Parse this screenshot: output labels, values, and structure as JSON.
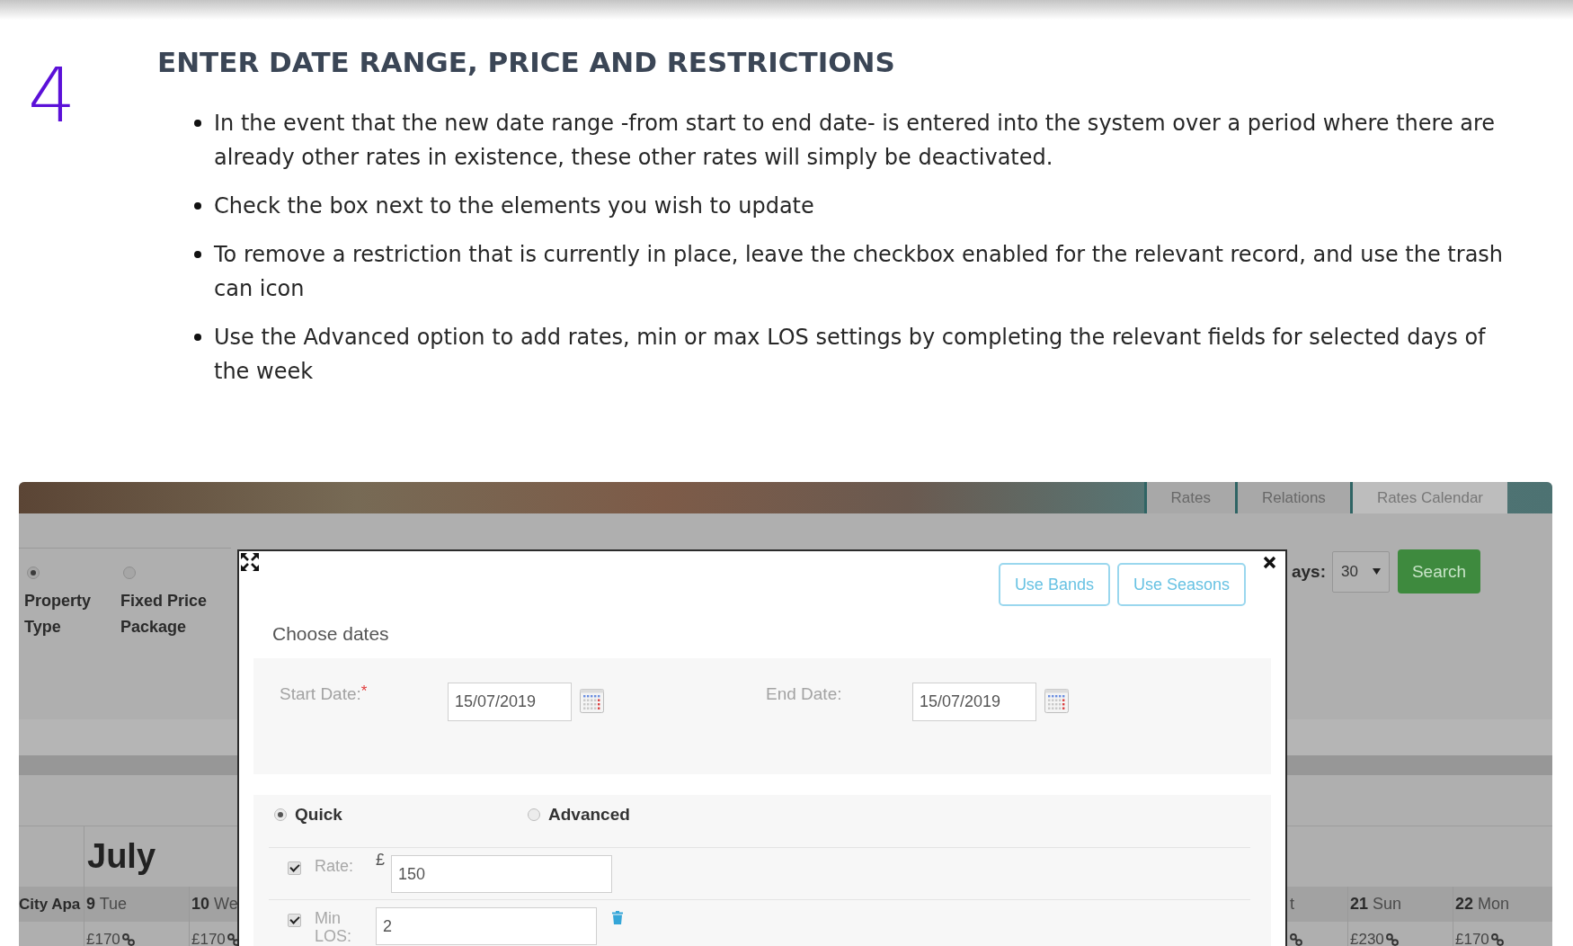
{
  "step": {
    "number": "4",
    "title": "ENTER DATE RANGE, PRICE AND RESTRICTIONS",
    "bullets": [
      "In the event that the new date range -from start to end date- is entered into the system over a period where there are already other rates in existence, these other rates will simply be deactivated.",
      "Check the box next to the elements you wish to update",
      "To remove a restriction that is currently in place, leave the checkbox enabled for the relevant record, and use the trash can icon",
      "Use the Advanced option to add rates, min or max LOS settings by completing the relevant fields for selected days of the week"
    ]
  },
  "screenshot": {
    "tabs": [
      {
        "label": "Rates",
        "selected": false
      },
      {
        "label": "Relations",
        "selected": false
      },
      {
        "label": "Rates Calendar",
        "selected": true
      }
    ],
    "view_options": [
      {
        "label": "Property Type",
        "selected": true
      },
      {
        "label": "Fixed Price Package",
        "selected": false
      }
    ],
    "days": {
      "label": "ays:",
      "value": "30"
    },
    "search_button": "Search",
    "calendar": {
      "month": "July",
      "property": "City Apa",
      "columns_left": [
        {
          "day": "9",
          "weekday": "Tue",
          "rate": "£170"
        },
        {
          "day": "10",
          "weekday": "We",
          "rate": "£170"
        }
      ],
      "columns_right": [
        {
          "weekday": "t"
        },
        {
          "day": "21",
          "weekday": "Sun",
          "rate": "£230"
        },
        {
          "day": "22",
          "weekday": "Mon",
          "rate": "£170"
        }
      ]
    },
    "modal": {
      "buttons": [
        "Use Bands",
        "Use Seasons"
      ],
      "section_title": "Choose dates",
      "start_date": {
        "label": "Start Date:",
        "required_mark": "*",
        "value": "15/07/2019"
      },
      "end_date": {
        "label": "End Date:",
        "value": "15/07/2019"
      },
      "modes": [
        {
          "label": "Quick",
          "selected": true
        },
        {
          "label": "Advanced",
          "selected": false
        }
      ],
      "fields": [
        {
          "label": "Rate:",
          "checked": true,
          "prefix": "£",
          "value": "150",
          "removable": false
        },
        {
          "label": "Min LOS:",
          "checked": true,
          "value": "2",
          "removable": true
        }
      ]
    }
  }
}
